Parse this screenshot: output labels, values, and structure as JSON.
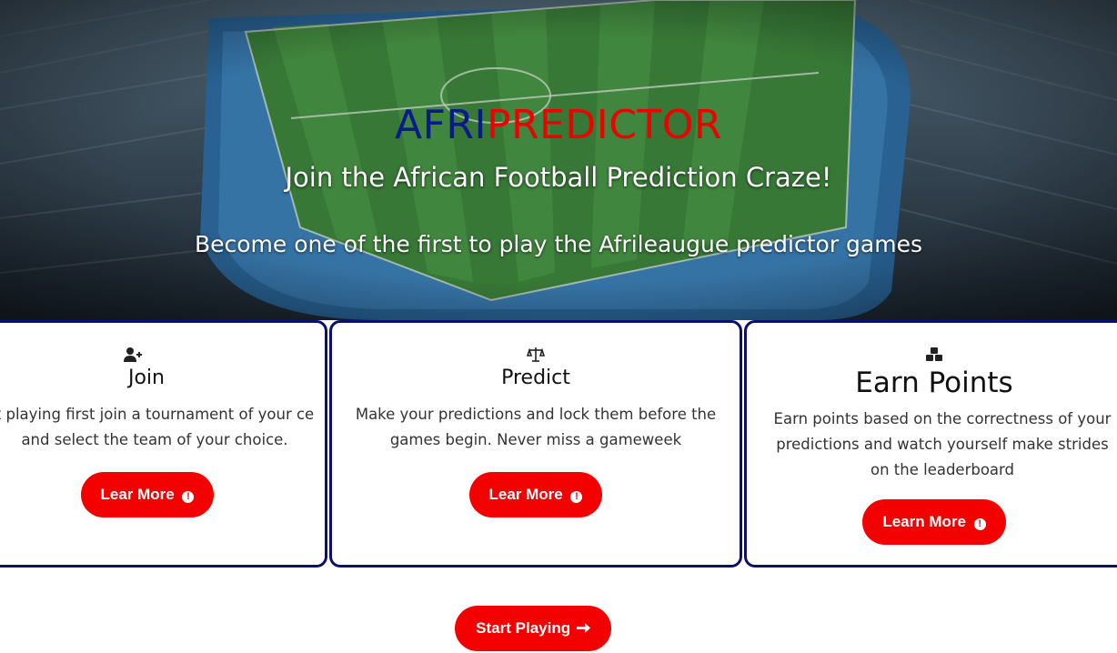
{
  "hero": {
    "brand_part1": "AFRI",
    "brand_part2": "PREDICTOR",
    "tagline": "Join the African Football Prediction Craze!",
    "subtitle": "Become one of the first to play the Afrileaugue predictor games"
  },
  "cards": [
    {
      "icon": "user-plus-icon",
      "title": "Join",
      "text": "t playing first join a tournament of your ce and select the team of your choice.",
      "button": "Lear More"
    },
    {
      "icon": "scales-icon",
      "title": "Predict",
      "text": "Make your predictions and lock them before the games begin. Never miss a gameweek",
      "button": "Lear More"
    },
    {
      "icon": "cubes-icon",
      "title": "Earn Points",
      "text": "Earn points based on the correctness of your predictions and watch yourself make strides on the leaderboard",
      "button": "Learn More"
    }
  ],
  "cta": {
    "label": "Start Playing"
  },
  "colors": {
    "accent": "#f50000",
    "brand_blue": "#0a1a8c",
    "card_border": "#0b0f6e"
  }
}
